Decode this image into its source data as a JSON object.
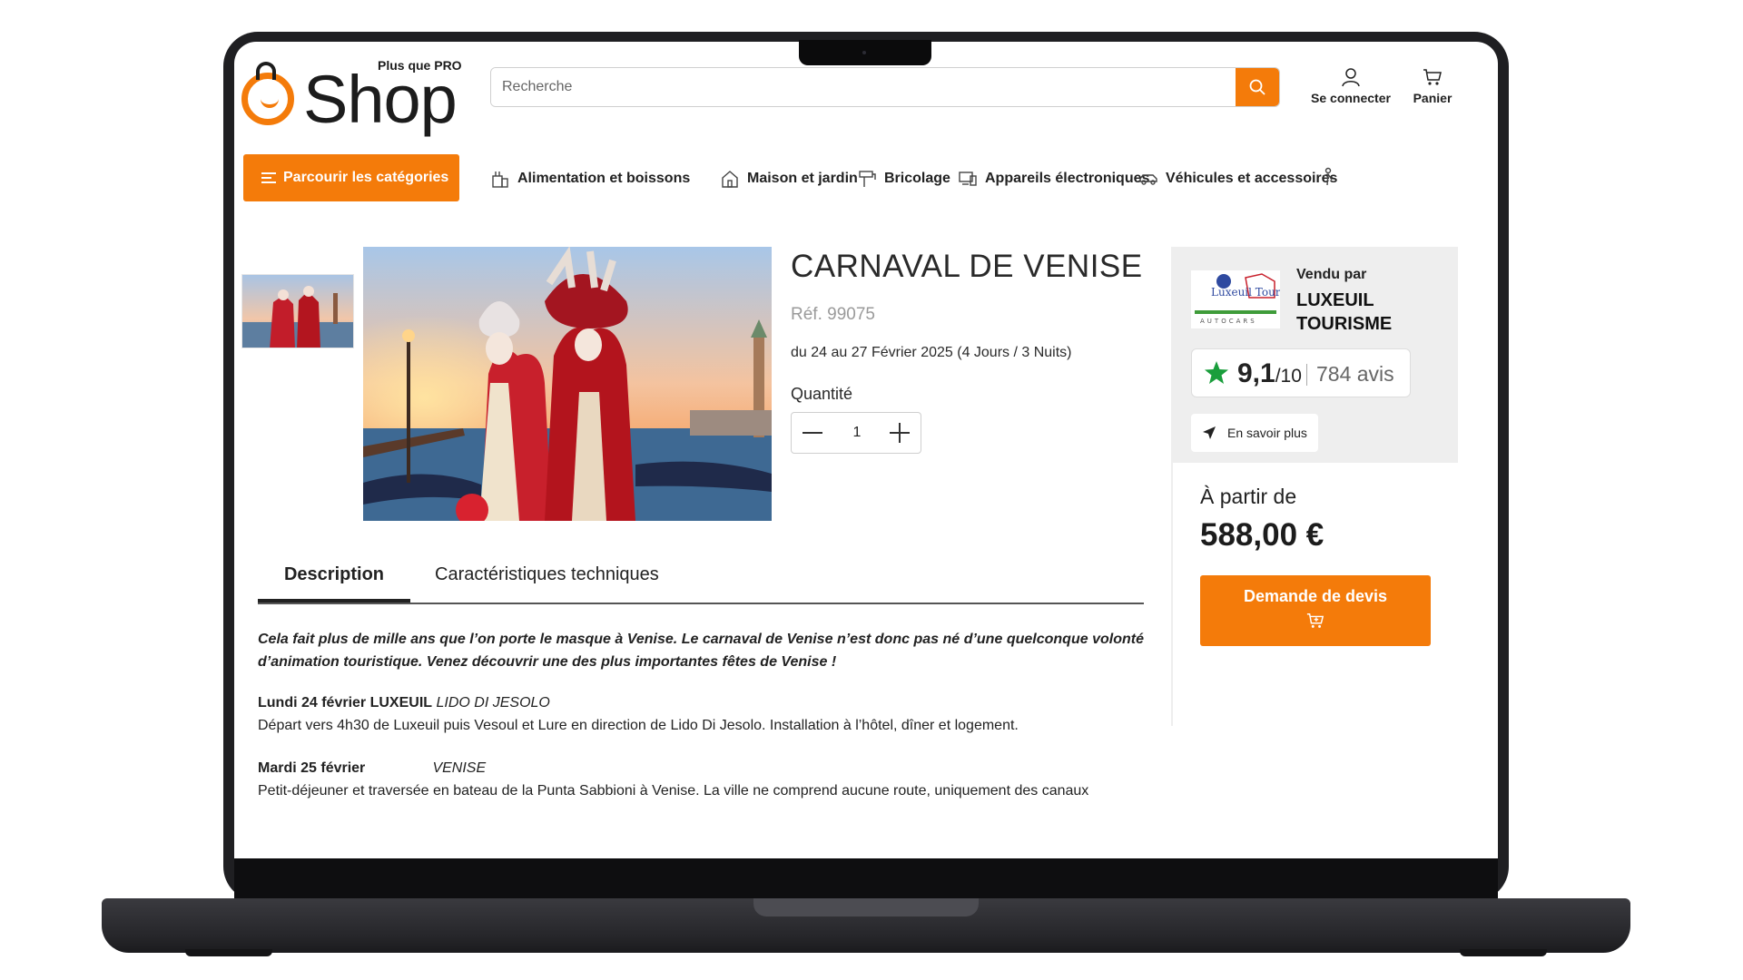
{
  "brand": {
    "tagline": "Plus que PRO",
    "wordmark": "Shop",
    "accent": "#f47b0a"
  },
  "header": {
    "search_placeholder": "Recherche",
    "login_label": "Se connecter",
    "cart_label": "Panier"
  },
  "nav": {
    "categories_button": "Parcourir les catégories",
    "items": [
      {
        "label": "Alimentation et boissons",
        "icon": "food-icon"
      },
      {
        "label": "Maison et jardin",
        "icon": "house-icon"
      },
      {
        "label": "Bricolage",
        "icon": "tools-icon"
      },
      {
        "label": "Appareils électroniques",
        "icon": "devices-icon"
      },
      {
        "label": "Véhicules et accessoires",
        "icon": "car-icon"
      }
    ]
  },
  "product": {
    "title": "CARNAVAL DE VENISE",
    "reference": "Réf. 99075",
    "dates": "du 24 au 27 Février 2025 (4 Jours / 3 Nuits)",
    "quantity_label": "Quantité",
    "quantity": "1"
  },
  "seller": {
    "sold_by": "Vendu par",
    "name": "LUXEUIL TOURISME",
    "logo_text": "Luxeuil Tourisme",
    "logo_sub": "AUTOCARS",
    "rating": "9,1",
    "rating_scale": "/10",
    "reviews": "784 avis",
    "more_button": "En savoir plus"
  },
  "pricing": {
    "from_label": "À partir de",
    "price": "588,00 €",
    "quote_button": "Demande de devis"
  },
  "tabs": {
    "description": "Description",
    "technical": "Caractéristiques techniques"
  },
  "description": {
    "intro": "Cela fait plus de mille ans que l’on porte le masque à Venise. Le carnaval de Venise n’est donc pas né d’une quelconque volonté d’animation touristique. Venez découvrir une des plus importantes fêtes de Venise !",
    "days": [
      {
        "title": "Lundi 24 février LUXEUIL",
        "place": "LIDO DI JESOLO",
        "text": "Départ vers 4h30 de Luxeuil puis Vesoul et Lure en direction de Lido Di Jesolo. Installation à l’hôtel, dîner et logement."
      },
      {
        "title": "Mardi 25 février",
        "place": "VENISE",
        "text": "Petit-déjeuner et traversée en bateau de la Punta Sabbioni à Venise. La ville ne comprend aucune route, uniquement des canaux"
      }
    ]
  }
}
